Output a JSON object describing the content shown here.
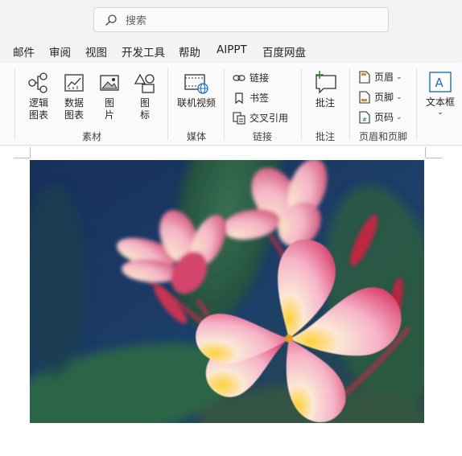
{
  "search": {
    "placeholder": "搜索",
    "icon": "search-icon"
  },
  "menu": [
    "邮件",
    "审阅",
    "视图",
    "开发工具",
    "帮助",
    "AIPPT",
    "百度网盘"
  ],
  "ribbon": {
    "groups": {
      "materials": {
        "label": "素材",
        "buttons": [
          {
            "label": "逻辑\n图表",
            "icon": "logic-chart-icon"
          },
          {
            "label": "数据\n图表",
            "icon": "data-chart-icon"
          },
          {
            "label": "图\n片",
            "icon": "picture-icon"
          },
          {
            "label": "图\n标",
            "icon": "icons-icon"
          }
        ]
      },
      "media": {
        "label": "媒体",
        "buttons": [
          {
            "label": "联机视频",
            "icon": "online-video-icon"
          }
        ]
      },
      "links": {
        "label": "链接",
        "buttons": [
          {
            "label": "链接",
            "icon": "link-icon"
          },
          {
            "label": "书签",
            "icon": "bookmark-icon"
          },
          {
            "label": "交叉引用",
            "icon": "cross-reference-icon"
          }
        ]
      },
      "comments": {
        "label": "批注",
        "buttons": [
          {
            "label": "批注",
            "icon": "comment-icon"
          }
        ]
      },
      "header_footer": {
        "label": "页眉和页脚",
        "buttons": [
          {
            "label": "页眉",
            "icon": "header-icon"
          },
          {
            "label": "页脚",
            "icon": "footer-icon"
          },
          {
            "label": "页码",
            "icon": "page-number-icon"
          }
        ]
      },
      "text": {
        "buttons": [
          {
            "label": "文本框",
            "icon": "textbox-icon"
          }
        ]
      }
    }
  },
  "document": {
    "image_subject": "plumeria-flower-photo"
  },
  "colors": {
    "accent": "#1b6ec2",
    "ribbon_bg": "#fafafa",
    "titlebar_bg": "#f3f3f3"
  }
}
